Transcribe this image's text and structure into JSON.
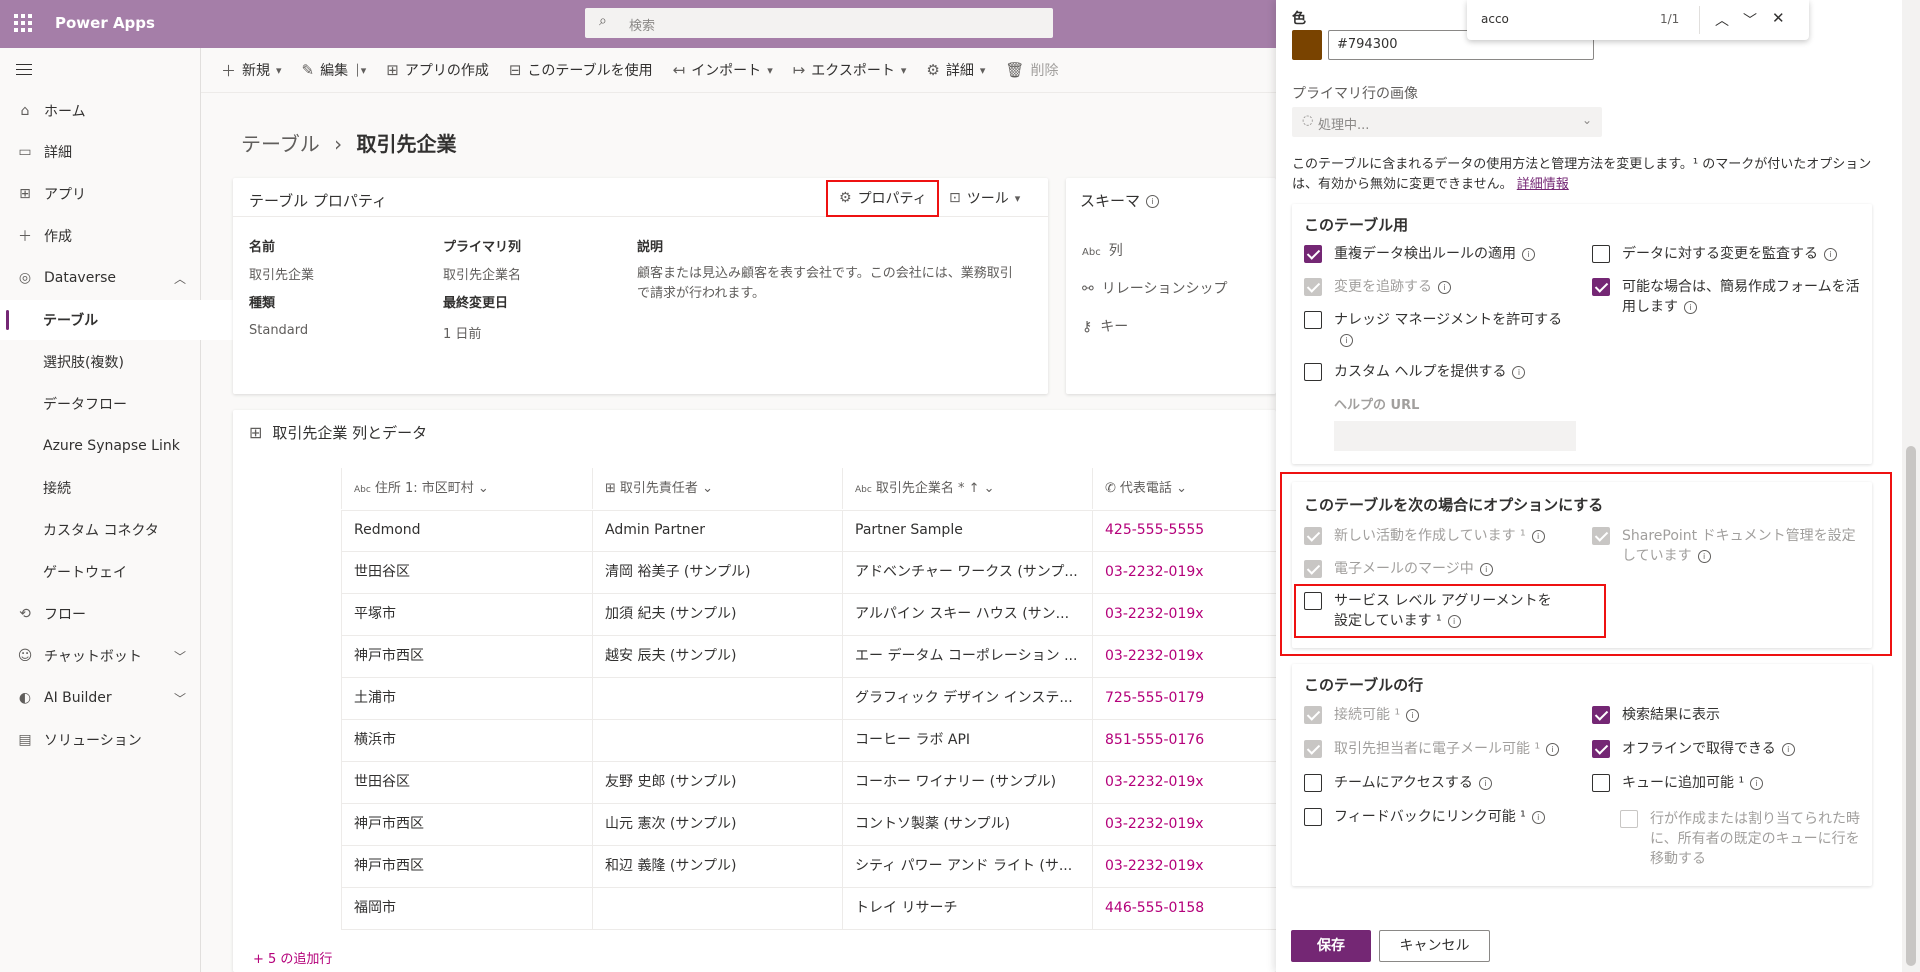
{
  "header": {
    "app_title": "Power Apps",
    "search_placeholder": "検索"
  },
  "sidebar": {
    "items": [
      {
        "label": "ホーム",
        "icon": "home-icon"
      },
      {
        "label": "詳細",
        "icon": "book-icon"
      },
      {
        "label": "アプリ",
        "icon": "apps-icon"
      },
      {
        "label": "作成",
        "icon": "plus-icon"
      },
      {
        "label": "Dataverse",
        "icon": "dataverse-icon"
      },
      {
        "label": "テーブル"
      },
      {
        "label": "選択肢(複数)"
      },
      {
        "label": "データフロー"
      },
      {
        "label": "Azure Synapse Link"
      },
      {
        "label": "接続"
      },
      {
        "label": "カスタム コネクタ"
      },
      {
        "label": "ゲートウェイ"
      },
      {
        "label": "フロー",
        "icon": "flow-icon"
      },
      {
        "label": "チャットボット",
        "icon": "bot-icon"
      },
      {
        "label": "AI Builder",
        "icon": "ai-builder-icon"
      },
      {
        "label": "ソリューション",
        "icon": "solution-icon"
      }
    ]
  },
  "commandbar": {
    "new": "新規",
    "edit": "編集",
    "create_app": "アプリの作成",
    "use_table": "このテーブルを使用",
    "import": "インポート",
    "export": "エクスポート",
    "details": "詳細",
    "delete": "削除"
  },
  "breadcrumb": {
    "parent": "テーブル",
    "separator": "›",
    "current": "取引先企業"
  },
  "properties_card": {
    "title": "テーブル プロパティ",
    "properties_button": "プロパティ",
    "tools_button": "ツール",
    "name_label": "名前",
    "name_value": "取引先企業",
    "type_label": "種類",
    "type_value": "Standard",
    "primary_col_label": "プライマリ列",
    "primary_col_value": "取引先企業名",
    "modified_label": "最終変更日",
    "modified_value": "1 日前",
    "desc_label": "説明",
    "desc_value": "顧客または見込み顧客を表す会社です。この会社には、業務取引で請求が行われます。"
  },
  "schema_card": {
    "title": "スキーマ",
    "items": [
      "列",
      "リレーションシップ",
      "キー"
    ]
  },
  "data_section": {
    "title": "取引先企業 列とデータ",
    "more_rows": "+ 5 の追加行"
  },
  "grid": {
    "columns": [
      "住所 1: 市区町村",
      "取引先責任者",
      "取引先企業名 *",
      "代表電話"
    ],
    "rows": [
      [
        "Redmond",
        "Admin Partner",
        "Partner Sample",
        "425-555-5555"
      ],
      [
        "世田谷区",
        "清岡 裕美子 (サンプル)",
        "アドベンチャー ワークス (サンプ...",
        "03-2232-019x"
      ],
      [
        "平塚市",
        "加須 紀夫 (サンプル)",
        "アルパイン スキー ハウス (サン...",
        "03-2232-019x"
      ],
      [
        "神戸市西区",
        "越安 辰夫 (サンプル)",
        "エー データム コーポレーション ...",
        "03-2232-019x"
      ],
      [
        "土浦市",
        "",
        "グラフィック デザイン インステ...",
        "725-555-0179"
      ],
      [
        "横浜市",
        "",
        "コーヒー ラボ API",
        "851-555-0176"
      ],
      [
        "世田谷区",
        "友野 史郎 (サンプル)",
        "コーホー ワイナリー (サンプル)",
        "03-2232-019x"
      ],
      [
        "神戸市西区",
        "山元 憲次 (サンプル)",
        "コントソ製薬 (サンプル)",
        "03-2232-019x"
      ],
      [
        "神戸市西区",
        "和辺 義隆 (サンプル)",
        "シティ パワー アンド ライト (サ...",
        "03-2232-019x"
      ],
      [
        "福岡市",
        "",
        "トレイ リサーチ",
        "446-555-0158"
      ]
    ]
  },
  "panel": {
    "color_label": "色",
    "color_value": "#794300",
    "color_swatch": "#794300",
    "image_label": "プライマリ行の画像",
    "image_value": "処理中...",
    "note": "このテーブルに含まれるデータの使用方法と管理方法を変更します。¹ のマークが付いたオプションは、有効から無効に変更できません。",
    "more_info": "詳細情報",
    "section1_title": "このテーブル用",
    "dup_detect": "重複データ検出ルールの適用",
    "track_changes": "変更を追跡する",
    "knowledge": "ナレッジ マネージメントを許可する",
    "custom_help": "カスタム ヘルプを提供する",
    "help_url_label": "ヘルプの URL",
    "audit": "データに対する変更を監査する",
    "quick_create": "可能な場合は、簡易作成フォームを活用します",
    "section2_title": "このテーブルを次の場合にオプションにする",
    "activities": "新しい活動を作成しています ¹",
    "email_merge": "電子メールのマージ中",
    "sla": "サービス レベル アグリーメントを設定しています ¹",
    "sharepoint": "SharePoint ドキュメント管理を設定しています",
    "section3_title": "このテーブルの行",
    "connectable": "接続可能 ¹",
    "email_contact": "取引先担当者に電子メール可能 ¹",
    "team_access": "チームにアクセスする",
    "feedback": "フィードバックにリンク可能 ¹",
    "show_search": "検索結果に表示",
    "offline": "オフラインで取得できる",
    "queue": "キューに追加可能 ¹",
    "queue_move": "行が作成または割り当てられた時に、所有者の既定のキューに行を移動する",
    "save": "保存",
    "cancel": "キャンセル"
  },
  "findbar": {
    "query": "acco",
    "count": "1/1"
  }
}
